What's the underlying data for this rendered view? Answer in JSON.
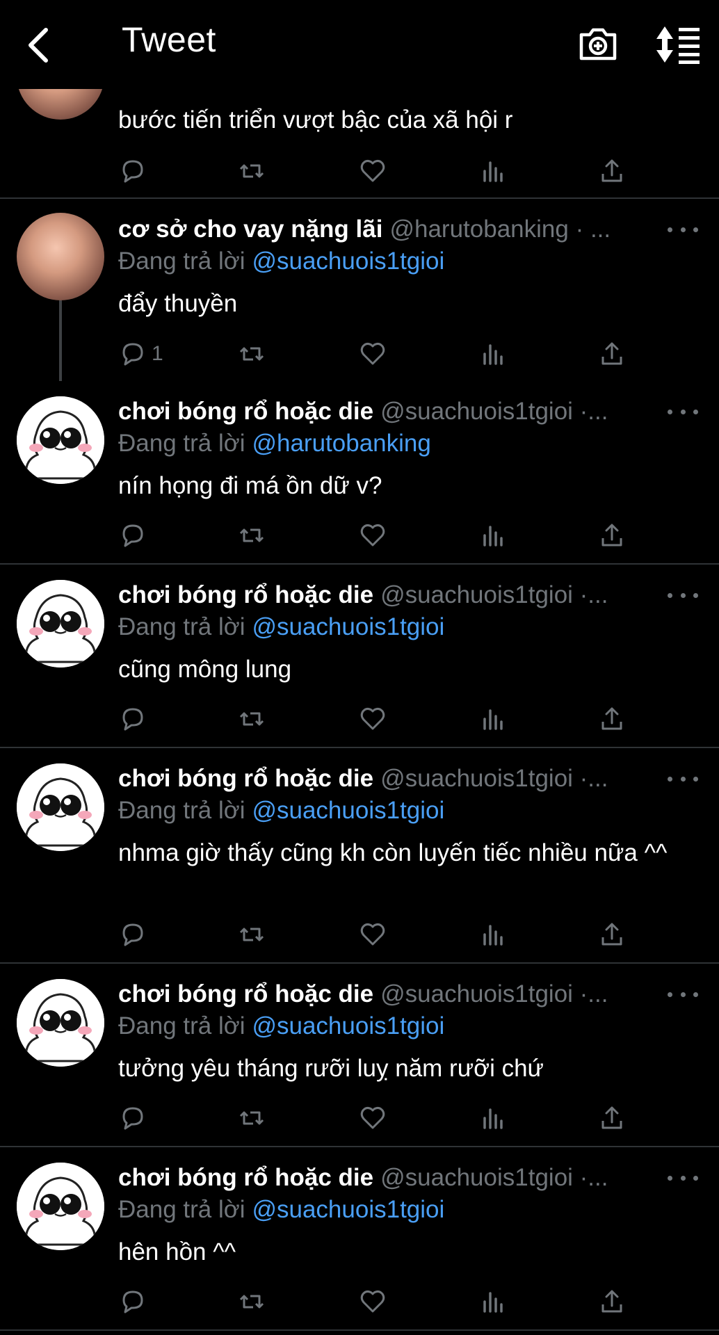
{
  "header": {
    "title": "Tweet"
  },
  "reply_prefix": "Đang trả lời",
  "tweets": [
    {
      "name": "",
      "handle": "",
      "reply_to": "",
      "text": "bước tiến triển vượt bậc của xã hội r",
      "reply_count": ""
    },
    {
      "name": "cơ sở cho vay nặng lãi",
      "handle": "@harutobanking · ...",
      "reply_to": "@suachuois1tgioi",
      "text": "đẩy thuyền",
      "reply_count": "1"
    },
    {
      "name": "chơi bóng rổ hoặc die",
      "handle": "@suachuois1tgioi ·...",
      "reply_to": "@harutobanking",
      "text": "nín họng đi má ồn dữ v?",
      "reply_count": ""
    },
    {
      "name": "chơi bóng rổ hoặc die",
      "handle": "@suachuois1tgioi ·...",
      "reply_to": "@suachuois1tgioi",
      "text": "cũng mông lung",
      "reply_count": ""
    },
    {
      "name": "chơi bóng rổ hoặc die",
      "handle": "@suachuois1tgioi ·...",
      "reply_to": "@suachuois1tgioi",
      "text": "nhma giờ thấy cũng kh còn luyến tiếc nhiều nữa ^^",
      "reply_count": ""
    },
    {
      "name": "chơi bóng rổ hoặc die",
      "handle": "@suachuois1tgioi ·...",
      "reply_to": "@suachuois1tgioi",
      "text": "tưởng yêu tháng rưỡi luỵ năm rưỡi chứ",
      "reply_count": ""
    },
    {
      "name": "chơi bóng rổ hoặc die",
      "handle": "@suachuois1tgioi ·...",
      "reply_to": "@suachuois1tgioi",
      "text": "hên hồn ^^",
      "reply_count": ""
    }
  ],
  "colors": {
    "background": "#000000",
    "text": "#ffffff",
    "muted": "#71767b",
    "link": "#4a9ff5",
    "divider": "#2f3336"
  }
}
